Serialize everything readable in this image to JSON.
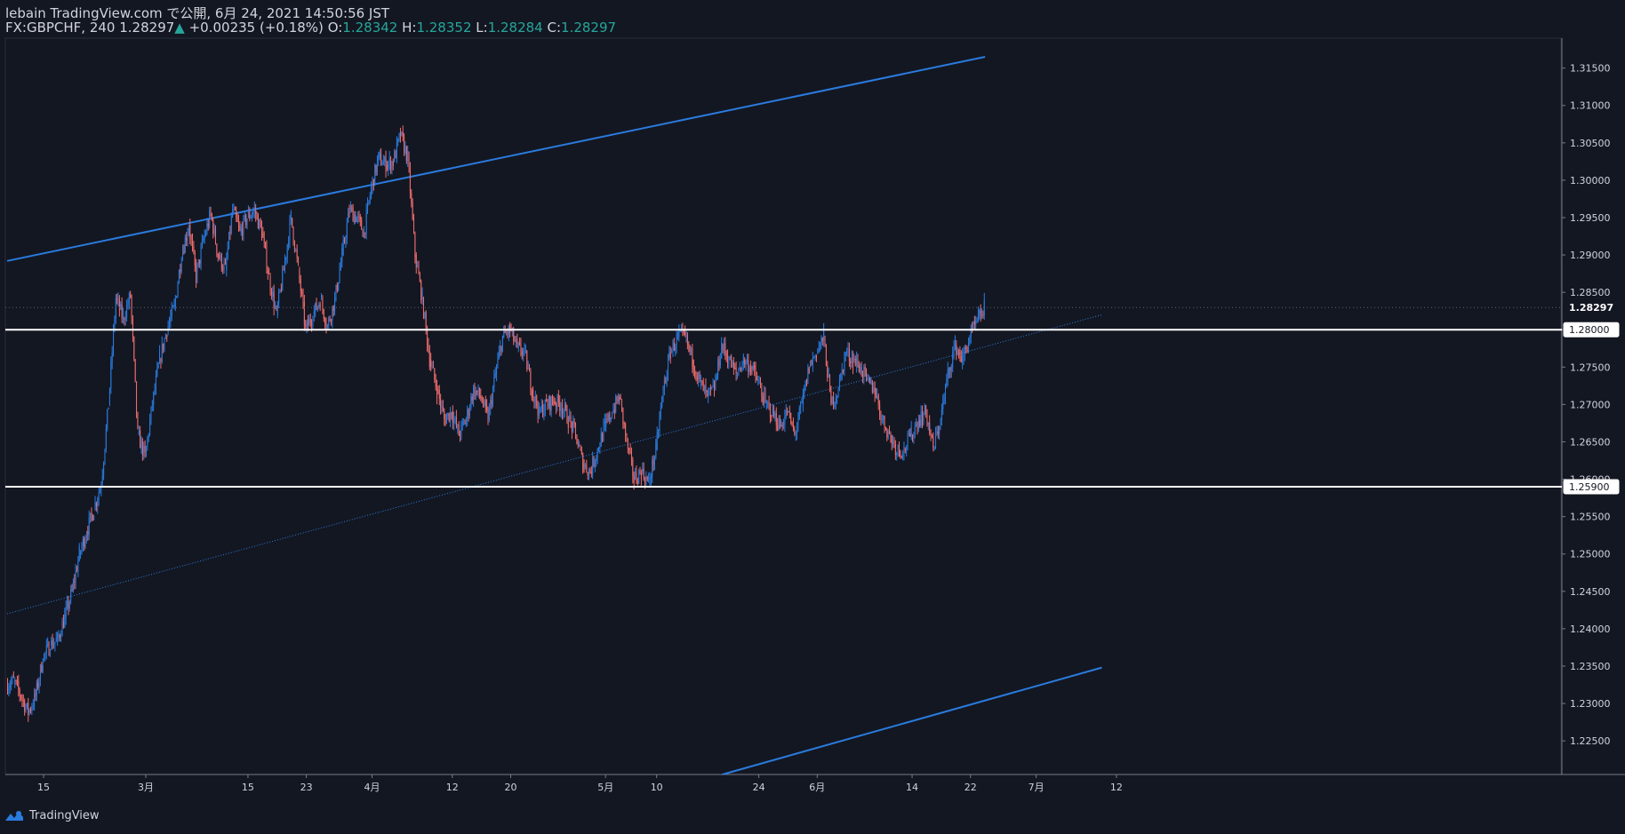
{
  "header": {
    "line1": "lebain TradingView.com で公開, 6月 24, 2021 14:50:56 JST",
    "symbol": "FX:GBPCHF, 240",
    "last": "1.28297",
    "change": "+0.00235 (+0.18%)",
    "o_label": "O:",
    "o_value": "1.28342",
    "h_label": "H:",
    "h_value": "1.28352",
    "l_label": "L:",
    "l_value": "1.28284",
    "c_label": "C:",
    "c_value": "1.28297"
  },
  "footer": {
    "brand": "TradingView",
    "logo_icon": "tradingview-logo-icon"
  },
  "colors": {
    "background": "#131722",
    "up": "#2a7bde",
    "down": "#ef6c6c",
    "trendline": "#2a7bde",
    "level": "#ffffff",
    "axis_text": "#d1d4dc"
  },
  "chart_data": {
    "type": "candlestick",
    "symbol": "GBPCHF",
    "timeframe": "240",
    "ylim": [
      1.2205,
      1.319
    ],
    "y_ticks": [
      "1.22500",
      "1.23000",
      "1.23500",
      "1.24000",
      "1.24500",
      "1.25000",
      "1.25500",
      "1.26000",
      "1.26500",
      "1.27000",
      "1.27500",
      "1.28000",
      "1.28500",
      "1.29000",
      "1.29500",
      "1.30000",
      "1.30500",
      "1.31000",
      "1.31500"
    ],
    "x_ticks": [
      {
        "label": "15",
        "date": "2021-02-15"
      },
      {
        "label": "3月",
        "date": "2021-03-01"
      },
      {
        "label": "15",
        "date": "2021-03-15"
      },
      {
        "label": "23",
        "date": "2021-03-23"
      },
      {
        "label": "4月",
        "date": "2021-04-01"
      },
      {
        "label": "12",
        "date": "2021-04-12"
      },
      {
        "label": "20",
        "date": "2021-04-20"
      },
      {
        "label": "5月",
        "date": "2021-05-03"
      },
      {
        "label": "10",
        "date": "2021-05-10"
      },
      {
        "label": "24",
        "date": "2021-05-24"
      },
      {
        "label": "6月",
        "date": "2021-06-01"
      },
      {
        "label": "14",
        "date": "2021-06-14"
      },
      {
        "label": "22",
        "date": "2021-06-22"
      },
      {
        "label": "7月",
        "date": "2021-07-01"
      },
      {
        "label": "12",
        "date": "2021-07-12"
      }
    ],
    "price_labels": [
      {
        "value": 1.28297,
        "text": "1.28297",
        "style": "last"
      },
      {
        "value": 1.28,
        "text": "1.28000",
        "style": "level"
      },
      {
        "value": 1.259,
        "text": "1.25900",
        "style": "level"
      }
    ],
    "horizontal_levels": [
      1.28,
      1.259
    ],
    "path": [
      [
        "2021-02-10",
        1.2325
      ],
      [
        "2021-02-11",
        1.233
      ],
      [
        "2021-02-12",
        1.231
      ],
      [
        "2021-02-13",
        1.2288
      ],
      [
        "2021-02-14",
        1.231
      ],
      [
        "2021-02-15",
        1.236
      ],
      [
        "2021-02-16",
        1.2378
      ],
      [
        "2021-02-17",
        1.2385
      ],
      [
        "2021-02-18",
        1.2415
      ],
      [
        "2021-02-19",
        1.245
      ],
      [
        "2021-02-20",
        1.25
      ],
      [
        "2021-02-21",
        1.253
      ],
      [
        "2021-02-22",
        1.256
      ],
      [
        "2021-02-23",
        1.2595
      ],
      [
        "2021-02-24",
        1.27
      ],
      [
        "2021-02-25",
        1.2842
      ],
      [
        "2021-02-26",
        1.2815
      ],
      [
        "2021-02-27",
        1.2845
      ],
      [
        "2021-02-28",
        1.266
      ],
      [
        "2021-03-01",
        1.263
      ],
      [
        "2021-03-02",
        1.27
      ],
      [
        "2021-03-03",
        1.276
      ],
      [
        "2021-03-04",
        1.28
      ],
      [
        "2021-03-05",
        1.283
      ],
      [
        "2021-03-06",
        1.29
      ],
      [
        "2021-03-07",
        1.294
      ],
      [
        "2021-03-08",
        1.287
      ],
      [
        "2021-03-09",
        1.292
      ],
      [
        "2021-03-10",
        1.2955
      ],
      [
        "2021-03-11",
        1.29
      ],
      [
        "2021-03-12",
        1.288
      ],
      [
        "2021-03-13",
        1.296
      ],
      [
        "2021-03-14",
        1.293
      ],
      [
        "2021-03-15",
        1.295
      ],
      [
        "2021-03-16",
        1.296
      ],
      [
        "2021-03-17",
        1.293
      ],
      [
        "2021-03-18",
        1.287
      ],
      [
        "2021-03-19",
        1.282
      ],
      [
        "2021-03-20",
        1.288
      ],
      [
        "2021-03-21",
        1.295
      ],
      [
        "2021-03-22",
        1.288
      ],
      [
        "2021-03-23",
        1.28
      ],
      [
        "2021-03-24",
        1.282
      ],
      [
        "2021-03-25",
        1.284
      ],
      [
        "2021-03-26",
        1.2805
      ],
      [
        "2021-03-27",
        1.284
      ],
      [
        "2021-03-28",
        1.29
      ],
      [
        "2021-03-29",
        1.296
      ],
      [
        "2021-03-30",
        1.295
      ],
      [
        "2021-03-31",
        1.293
      ],
      [
        "2021-04-01",
        1.299
      ],
      [
        "2021-04-02",
        1.303
      ],
      [
        "2021-04-03",
        1.302
      ],
      [
        "2021-04-04",
        1.3025
      ],
      [
        "2021-04-05",
        1.306
      ],
      [
        "2021-04-06",
        1.303
      ],
      [
        "2021-04-07",
        1.29
      ],
      [
        "2021-04-08",
        1.284
      ],
      [
        "2021-04-09",
        1.276
      ],
      [
        "2021-04-10",
        1.272
      ],
      [
        "2021-04-11",
        1.268
      ],
      [
        "2021-04-12",
        1.269
      ],
      [
        "2021-04-13",
        1.266
      ],
      [
        "2021-04-14",
        1.268
      ],
      [
        "2021-04-15",
        1.272
      ],
      [
        "2021-04-16",
        1.271
      ],
      [
        "2021-04-17",
        1.268
      ],
      [
        "2021-04-18",
        1.274
      ],
      [
        "2021-04-19",
        1.279
      ],
      [
        "2021-04-20",
        1.28
      ],
      [
        "2021-04-21",
        1.2775
      ],
      [
        "2021-04-22",
        1.277
      ],
      [
        "2021-04-23",
        1.272
      ],
      [
        "2021-04-24",
        1.269
      ],
      [
        "2021-04-25",
        1.27
      ],
      [
        "2021-04-26",
        1.2705
      ],
      [
        "2021-04-27",
        1.27
      ],
      [
        "2021-04-28",
        1.268
      ],
      [
        "2021-04-29",
        1.266
      ],
      [
        "2021-04-30",
        1.262
      ],
      [
        "2021-05-01",
        1.261
      ],
      [
        "2021-05-02",
        1.264
      ],
      [
        "2021-05-03",
        1.267
      ],
      [
        "2021-05-04",
        1.269
      ],
      [
        "2021-05-05",
        1.271
      ],
      [
        "2021-05-06",
        1.265
      ],
      [
        "2021-05-07",
        1.26
      ],
      [
        "2021-05-08",
        1.261
      ],
      [
        "2021-05-09",
        1.2595
      ],
      [
        "2021-05-10",
        1.264
      ],
      [
        "2021-05-11",
        1.272
      ],
      [
        "2021-05-12",
        1.277
      ],
      [
        "2021-05-13",
        1.279
      ],
      [
        "2021-05-14",
        1.279
      ],
      [
        "2021-05-15",
        1.276
      ],
      [
        "2021-05-16",
        1.273
      ],
      [
        "2021-05-17",
        1.271
      ],
      [
        "2021-05-18",
        1.272
      ],
      [
        "2021-05-19",
        1.278
      ],
      [
        "2021-05-20",
        1.276
      ],
      [
        "2021-05-21",
        1.274
      ],
      [
        "2021-05-22",
        1.276
      ],
      [
        "2021-05-23",
        1.275
      ],
      [
        "2021-05-24",
        1.273
      ],
      [
        "2021-05-25",
        1.27
      ],
      [
        "2021-05-26",
        1.269
      ],
      [
        "2021-05-27",
        1.267
      ],
      [
        "2021-05-28",
        1.269
      ],
      [
        "2021-05-29",
        1.266
      ],
      [
        "2021-05-30",
        1.27
      ],
      [
        "2021-05-31",
        1.275
      ],
      [
        "2021-06-01",
        1.277
      ],
      [
        "2021-06-02",
        1.279
      ],
      [
        "2021-06-03",
        1.27
      ],
      [
        "2021-06-04",
        1.272
      ],
      [
        "2021-06-05",
        1.277
      ],
      [
        "2021-06-06",
        1.276
      ],
      [
        "2021-06-07",
        1.275
      ],
      [
        "2021-06-08",
        1.273
      ],
      [
        "2021-06-09",
        1.272
      ],
      [
        "2021-06-10",
        1.268
      ],
      [
        "2021-06-11",
        1.266
      ],
      [
        "2021-06-12",
        1.264
      ],
      [
        "2021-06-13",
        1.264
      ],
      [
        "2021-06-14",
        1.266
      ],
      [
        "2021-06-15",
        1.268
      ],
      [
        "2021-06-16",
        1.269
      ],
      [
        "2021-06-17",
        1.264
      ],
      [
        "2021-06-18",
        1.268
      ],
      [
        "2021-06-19",
        1.274
      ],
      [
        "2021-06-20",
        1.278
      ],
      [
        "2021-06-21",
        1.276
      ],
      [
        "2021-06-22",
        1.279
      ],
      [
        "2021-06-23",
        1.281
      ],
      [
        "2021-06-24",
        1.283
      ]
    ]
  }
}
